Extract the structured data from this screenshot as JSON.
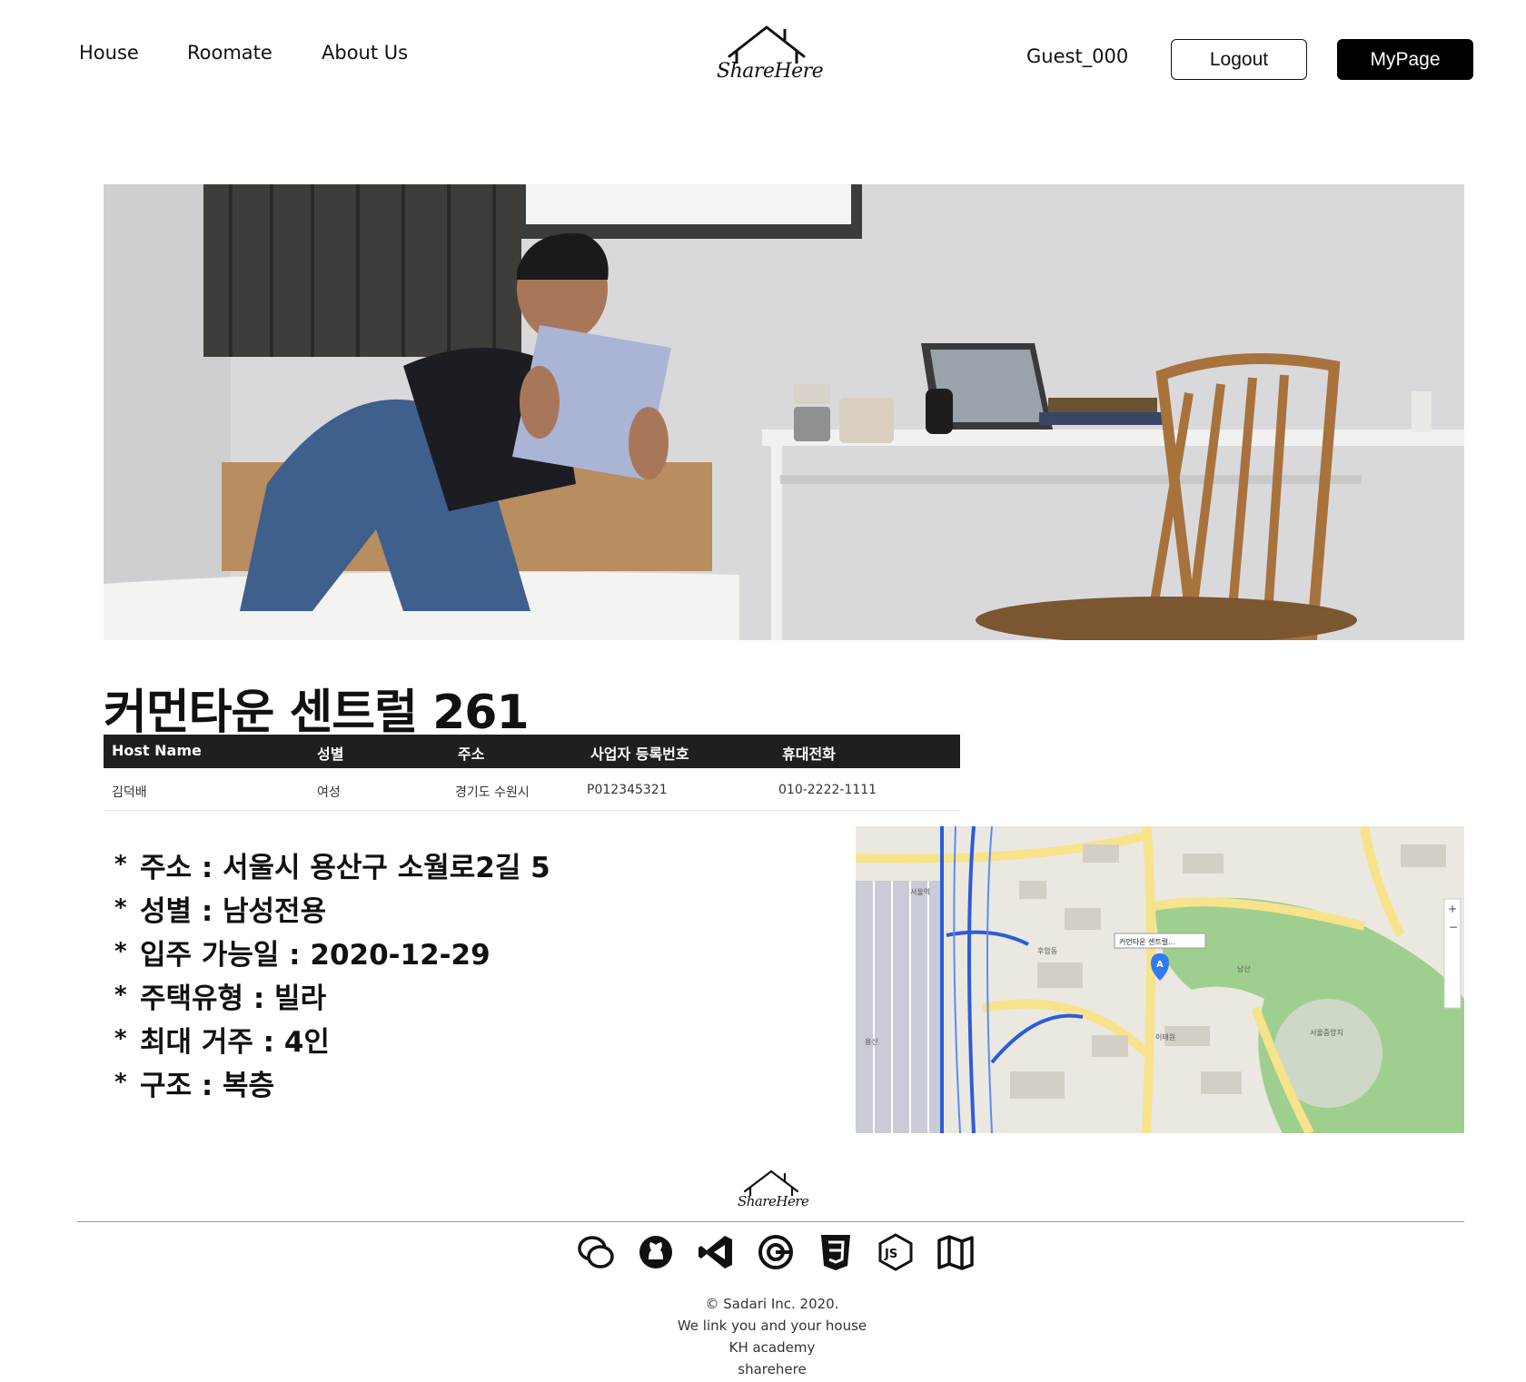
{
  "header": {
    "nav": [
      "House",
      "Roomate",
      "About Us"
    ],
    "logo_text": "ShareHere",
    "username": "Guest_000",
    "logout_label": "Logout",
    "mypage_label": "MyPage"
  },
  "listing": {
    "title": "커먼타운 센트럴 261",
    "table": {
      "headers": [
        "Host Name",
        "성별",
        "주소",
        "사업자 등록번호",
        "휴대전화"
      ],
      "row": [
        "김덕배",
        "여성",
        "경기도 수원시",
        "P012345321",
        "010-2222-1111"
      ]
    },
    "details": [
      "주소 : 서울시 용산구 소월로2길 5",
      "성별 : 남성전용",
      "입주 가능일 : 2020-12-29",
      "주택유형 : 빌라",
      "최대 거주 : 4인",
      "구조 : 복층"
    ]
  },
  "map": {
    "popup_label": "커먼타운 센트럴...",
    "labels": [
      "서울역",
      "남산",
      "후암동",
      "이태원",
      "용산",
      "서울중앙지"
    ]
  },
  "footer": {
    "logo_text": "ShareHere",
    "icons": [
      "chat-icon",
      "github-icon",
      "vscode-icon",
      "google-icon",
      "css3-icon",
      "nodejs-icon",
      "map-icon"
    ],
    "lines": [
      "© Sadari Inc. 2020.",
      "We link you and your house",
      "KH academy",
      "sharehere"
    ]
  },
  "colors": {
    "table_header": "#1f1f1f",
    "button_dark": "#000000",
    "map_park": "#9fcf8f",
    "map_road": "#f6e38c",
    "map_rail": "#2d5bd8"
  }
}
